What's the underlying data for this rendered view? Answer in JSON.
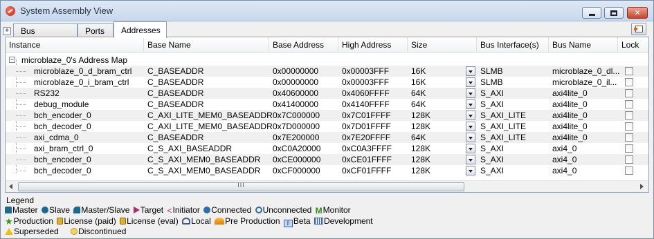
{
  "window": {
    "title": "System Assembly View"
  },
  "tabs": [
    {
      "label": "Bus Interfaces"
    },
    {
      "label": "Ports"
    },
    {
      "label": "Addresses"
    }
  ],
  "table": {
    "headers": [
      "Instance",
      "Base Name",
      "Base Address",
      "High Address",
      "Size",
      "Bus Interface(s)",
      "Bus Name",
      "Lock"
    ],
    "root_label": "microblaze_0's Address Map",
    "rows": [
      {
        "instance": "microblaze_0_d_bram_ctrl",
        "base_name": "C_BASEADDR",
        "base_addr": "0x00000000",
        "high_addr": "0x00003FFF",
        "size": "16K",
        "bus_if": "SLMB",
        "bus_name": "microblaze_0_dl..."
      },
      {
        "instance": "microblaze_0_i_bram_ctrl",
        "base_name": "C_BASEADDR",
        "base_addr": "0x00000000",
        "high_addr": "0x00003FFF",
        "size": "16K",
        "bus_if": "SLMB",
        "bus_name": "microblaze_0_il..."
      },
      {
        "instance": "RS232",
        "base_name": "C_BASEADDR",
        "base_addr": "0x40600000",
        "high_addr": "0x4060FFFF",
        "size": "64K",
        "bus_if": "S_AXI",
        "bus_name": "axi4lite_0"
      },
      {
        "instance": "debug_module",
        "base_name": "C_BASEADDR",
        "base_addr": "0x41400000",
        "high_addr": "0x4140FFFF",
        "size": "64K",
        "bus_if": "S_AXI",
        "bus_name": "axi4lite_0"
      },
      {
        "instance": "bch_encoder_0",
        "base_name": "C_AXI_LITE_MEM0_BASEADDR",
        "base_addr": "0x7C000000",
        "high_addr": "0x7C01FFFF",
        "size": "128K",
        "bus_if": "S_AXI_LITE",
        "bus_name": "axi4lite_0"
      },
      {
        "instance": "bch_decoder_0",
        "base_name": "C_AXI_LITE_MEM0_BASEADDR",
        "base_addr": "0x7D000000",
        "high_addr": "0x7D01FFFF",
        "size": "128K",
        "bus_if": "S_AXI_LITE",
        "bus_name": "axi4lite_0"
      },
      {
        "instance": "axi_cdma_0",
        "base_name": "C_BASEADDR",
        "base_addr": "0x7E200000",
        "high_addr": "0x7E20FFFF",
        "size": "64K",
        "bus_if": "S_AXI_LITE",
        "bus_name": "axi4lite_0"
      },
      {
        "instance": "axi_bram_ctrl_0",
        "base_name": "C_S_AXI_BASEADDR",
        "base_addr": "0xC0A20000",
        "high_addr": "0xC0A3FFFF",
        "size": "128K",
        "bus_if": "S_AXI",
        "bus_name": "axi4_0"
      },
      {
        "instance": "bch_encoder_0",
        "base_name": "C_S_AXI_MEM0_BASEADDR",
        "base_addr": "0xCE000000",
        "high_addr": "0xCE01FFFF",
        "size": "128K",
        "bus_if": "S_AXI",
        "bus_name": "axi4_0"
      },
      {
        "instance": "bch_decoder_0",
        "base_name": "C_S_AXI_MEM0_BASEADDR",
        "base_addr": "0xCF000000",
        "high_addr": "0xCF01FFFF",
        "size": "128K",
        "bus_if": "S_AXI",
        "bus_name": "axi4_0"
      }
    ]
  },
  "scroll": {
    "grip": "III"
  },
  "legend": {
    "title": "Legend",
    "items": [
      {
        "icon": "master-icon",
        "label": "Master"
      },
      {
        "icon": "slave-icon",
        "label": "Slave"
      },
      {
        "icon": "master-slave-icon",
        "label": "Master/Slave"
      },
      {
        "icon": "target-icon",
        "label": "Target"
      },
      {
        "icon": "initiator-icon",
        "label": "Initiator"
      },
      {
        "icon": "connected-icon",
        "label": "Connected"
      },
      {
        "icon": "unconnected-icon",
        "label": "Unconnected"
      },
      {
        "icon": "monitor-icon",
        "label": "Monitor"
      },
      {
        "icon": "production-icon",
        "label": "Production"
      },
      {
        "icon": "license-paid-icon",
        "label": "License (paid)"
      },
      {
        "icon": "license-eval-icon",
        "label": "License (eval)"
      },
      {
        "icon": "local-icon",
        "label": "Local"
      },
      {
        "icon": "pre-production-icon",
        "label": "Pre Production"
      },
      {
        "icon": "beta-icon",
        "label": "Beta"
      },
      {
        "icon": "development-icon",
        "label": "Development"
      },
      {
        "icon": "superseded-icon",
        "label": "Superseded"
      },
      {
        "icon": "discontinued-icon",
        "label": "Discontinued"
      }
    ]
  }
}
